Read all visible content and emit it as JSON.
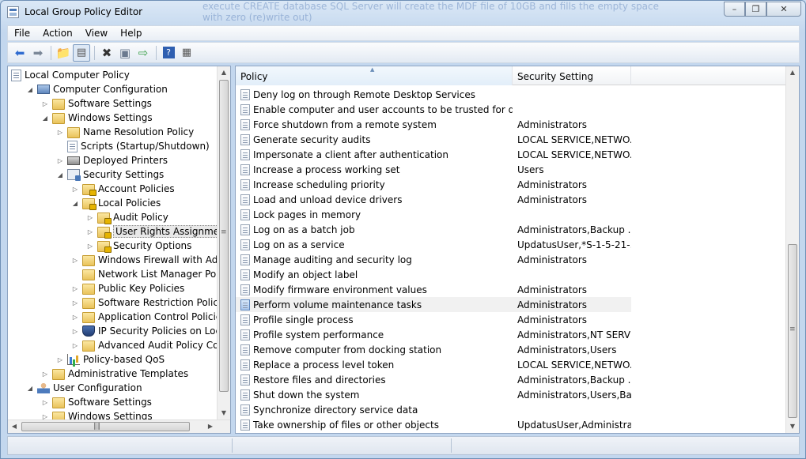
{
  "window": {
    "title": "Local Group Policy Editor",
    "background_text_line1": "execute CREATE database SQL Server will create the MDF file of 10GB and fills the empty space",
    "background_text_line2": "with zero (re)write out)"
  },
  "menu": [
    "File",
    "Action",
    "View",
    "Help"
  ],
  "toolbar": {
    "buttons": [
      "back-icon",
      "forward-icon",
      "up-folder-icon",
      "show-hide-tree-icon",
      "delete-icon",
      "properties-icon",
      "export-list-icon",
      "help-icon",
      "view-icon"
    ]
  },
  "tree": [
    {
      "label": "Local Computer Policy",
      "icon": "doc-icon",
      "level": 0,
      "twisty": ""
    },
    {
      "label": "Computer Configuration",
      "icon": "computer-icon",
      "level": 1,
      "twisty": "expanded"
    },
    {
      "label": "Software Settings",
      "icon": "folder-icon",
      "level": 2,
      "twisty": "collapsed"
    },
    {
      "label": "Windows Settings",
      "icon": "folder-icon",
      "level": 2,
      "twisty": "expanded"
    },
    {
      "label": "Name Resolution Policy",
      "icon": "folder-icon",
      "level": 3,
      "twisty": "collapsed"
    },
    {
      "label": "Scripts (Startup/Shutdown)",
      "icon": "doc-icon",
      "level": 3,
      "twisty": ""
    },
    {
      "label": "Deployed Printers",
      "icon": "printer-icon",
      "level": 3,
      "twisty": "collapsed"
    },
    {
      "label": "Security Settings",
      "icon": "security-icon",
      "level": 3,
      "twisty": "expanded"
    },
    {
      "label": "Account Policies",
      "icon": "locked-folder-icon",
      "level": 4,
      "twisty": "collapsed"
    },
    {
      "label": "Local Policies",
      "icon": "locked-folder-icon",
      "level": 4,
      "twisty": "expanded"
    },
    {
      "label": "Audit Policy",
      "icon": "locked-folder-icon",
      "level": 5,
      "twisty": "collapsed"
    },
    {
      "label": "User Rights Assignment",
      "icon": "locked-folder-icon",
      "level": 5,
      "twisty": "collapsed",
      "selected": true
    },
    {
      "label": "Security Options",
      "icon": "locked-folder-icon",
      "level": 5,
      "twisty": "collapsed"
    },
    {
      "label": "Windows Firewall with Advance",
      "icon": "folder-icon",
      "level": 4,
      "twisty": "collapsed"
    },
    {
      "label": "Network List Manager Policies",
      "icon": "folder-icon",
      "level": 4,
      "twisty": ""
    },
    {
      "label": "Public Key Policies",
      "icon": "folder-icon",
      "level": 4,
      "twisty": "collapsed"
    },
    {
      "label": "Software Restriction Policies",
      "icon": "folder-icon",
      "level": 4,
      "twisty": "collapsed"
    },
    {
      "label": "Application Control Policies",
      "icon": "folder-icon",
      "level": 4,
      "twisty": "collapsed"
    },
    {
      "label": "IP Security Policies on Local Co",
      "icon": "shield-icon",
      "level": 4,
      "twisty": "collapsed"
    },
    {
      "label": "Advanced Audit Policy Configu",
      "icon": "folder-icon",
      "level": 4,
      "twisty": "collapsed"
    },
    {
      "label": "Policy-based QoS",
      "icon": "chart-icon",
      "level": 3,
      "twisty": "collapsed"
    },
    {
      "label": "Administrative Templates",
      "icon": "folder-icon",
      "level": 2,
      "twisty": "collapsed"
    },
    {
      "label": "User Configuration",
      "icon": "user-icon",
      "level": 1,
      "twisty": "expanded"
    },
    {
      "label": "Software Settings",
      "icon": "folder-icon",
      "level": 2,
      "twisty": "collapsed"
    },
    {
      "label": "Windows Settings",
      "icon": "folder-icon",
      "level": 2,
      "twisty": "collapsed"
    }
  ],
  "list": {
    "columns": [
      "Policy",
      "Security Setting"
    ],
    "rows": [
      {
        "policy": "Deny log on through Remote Desktop Services",
        "setting": ""
      },
      {
        "policy": "Enable computer and user accounts to be trusted for delega...",
        "setting": ""
      },
      {
        "policy": "Force shutdown from a remote system",
        "setting": "Administrators"
      },
      {
        "policy": "Generate security audits",
        "setting": "LOCAL SERVICE,NETWO..."
      },
      {
        "policy": "Impersonate a client after authentication",
        "setting": "LOCAL SERVICE,NETWO..."
      },
      {
        "policy": "Increase a process working set",
        "setting": "Users"
      },
      {
        "policy": "Increase scheduling priority",
        "setting": "Administrators"
      },
      {
        "policy": "Load and unload device drivers",
        "setting": "Administrators"
      },
      {
        "policy": "Lock pages in memory",
        "setting": ""
      },
      {
        "policy": "Log on as a batch job",
        "setting": "Administrators,Backup ..."
      },
      {
        "policy": "Log on as a service",
        "setting": "UpdatusUser,*S-1-5-21-..."
      },
      {
        "policy": "Manage auditing and security log",
        "setting": "Administrators"
      },
      {
        "policy": "Modify an object label",
        "setting": ""
      },
      {
        "policy": "Modify firmware environment values",
        "setting": "Administrators"
      },
      {
        "policy": "Perform volume maintenance tasks",
        "setting": "Administrators",
        "selected": true
      },
      {
        "policy": "Profile single process",
        "setting": "Administrators"
      },
      {
        "policy": "Profile system performance",
        "setting": "Administrators,NT SERVI..."
      },
      {
        "policy": "Remove computer from docking station",
        "setting": "Administrators,Users"
      },
      {
        "policy": "Replace a process level token",
        "setting": "LOCAL SERVICE,NETWO..."
      },
      {
        "policy": "Restore files and directories",
        "setting": "Administrators,Backup ..."
      },
      {
        "policy": "Shut down the system",
        "setting": "Administrators,Users,Ba..."
      },
      {
        "policy": "Synchronize directory service data",
        "setting": ""
      },
      {
        "policy": "Take ownership of files or other objects",
        "setting": "UpdatusUser,Administra..."
      }
    ]
  }
}
